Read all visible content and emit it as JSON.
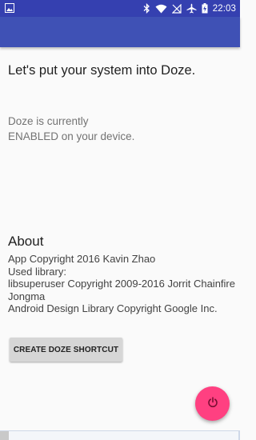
{
  "status_bar": {
    "time": "22:03",
    "icons": [
      "image-icon",
      "bluetooth-icon",
      "wifi-icon",
      "signal-off-icon",
      "airplane-icon",
      "battery-icon"
    ]
  },
  "toolbar": {
    "color": "#3f51b5"
  },
  "main": {
    "headline": "Let's put your system into Doze.",
    "status_line1": "Doze is currently",
    "status_line2": "ENABLED on your device."
  },
  "about": {
    "title": "About",
    "lines": [
      "App Copyright 2016 Kavin Zhao",
      "Used library:",
      "libsuperuser Copyright 2009-2016 Jorrit Chainfire Jongma",
      "Android Design Library Copyright Google Inc."
    ]
  },
  "buttons": {
    "shortcut_label": "CREATE DOZE SHORTCUT",
    "fab_icon": "power-icon",
    "fab_color": "#ff4081"
  }
}
